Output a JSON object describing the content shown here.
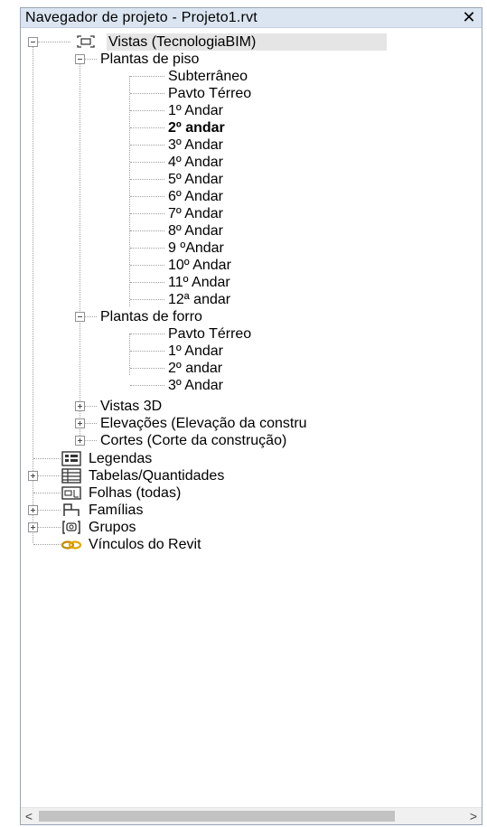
{
  "window": {
    "title": "Navegador de projeto - Projeto1.rvt",
    "close_symbol": "✕"
  },
  "tree": {
    "views_root": "Vistas (TecnologiaBIM)",
    "floor_plans": "Plantas de piso",
    "floor_items": [
      "Subterrâneo",
      "Pavto Térreo",
      "1º Andar",
      "2º andar",
      "3º Andar",
      "4º Andar",
      "5º Andar",
      "6º Andar",
      "7º Andar",
      "8º Andar",
      "9 ºAndar",
      "10º Andar",
      "11º Andar",
      "12ª andar"
    ],
    "selected_floor": "2º andar",
    "ceiling_plans": "Plantas de forro",
    "ceiling_items": [
      "Pavto Térreo",
      "1º Andar",
      "2º andar",
      "3º Andar"
    ],
    "views_3d": "Vistas 3D",
    "elevations": "Elevações (Elevação da constru",
    "sections": "Cortes (Corte da construção)",
    "legends": "Legendas",
    "schedules": "Tabelas/Quantidades",
    "sheets": "Folhas (todas)",
    "families": "Famílias",
    "groups": "Grupos",
    "revit_links": "Vínculos do Revit"
  },
  "icons": {
    "views": "views-icon",
    "legends": "legend-icon",
    "schedules": "schedule-icon",
    "sheets": "sheet-icon",
    "families": "family-icon",
    "groups": "group-icon",
    "links": "link-icon"
  },
  "scroll": {
    "left": "<",
    "right": ">"
  }
}
